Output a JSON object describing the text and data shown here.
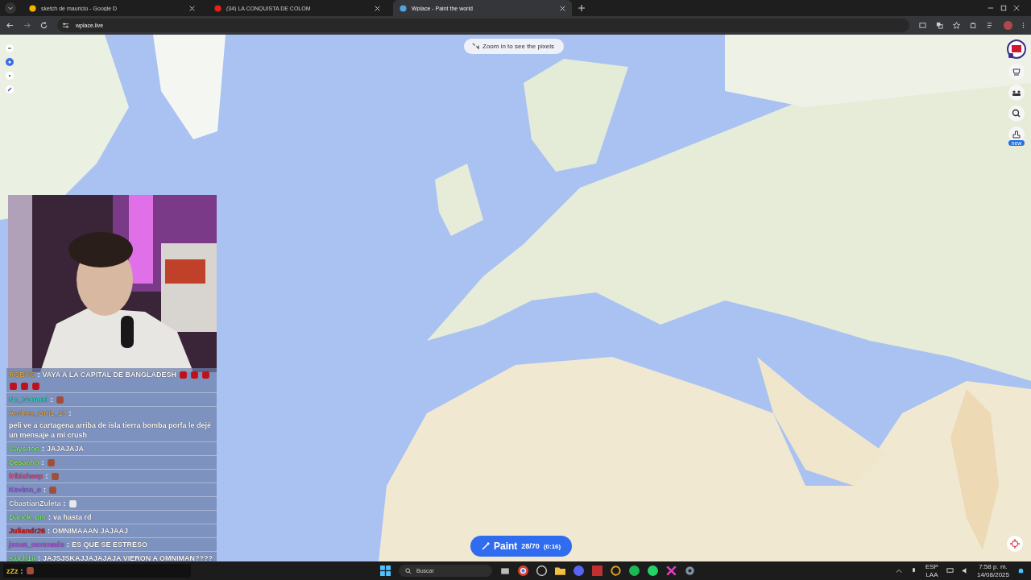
{
  "browser": {
    "tabs": [
      {
        "title": "sketch de mauricio - Google D",
        "selected": false
      },
      {
        "title": "(34) LA CONQUISTA DE COLOM",
        "selected": false
      },
      {
        "title": "Wplace - Paint the world",
        "selected": true
      }
    ],
    "url": "wplace.live"
  },
  "map": {
    "kind": "picture",
    "hint": "Zoom in to see the pixels",
    "paint": {
      "label": "Paint",
      "count": "28/70",
      "timer": "(0:16)"
    },
    "badge": "new"
  },
  "chat_separator": ":",
  "chat": [
    {
      "user": "ROBYC",
      "color": "#d9a441",
      "parts": [
        {
          "kind": "text",
          "text": "VAYA A LA CAPITAL DE BANGLADESH"
        },
        {
          "kind": "emote",
          "color": "#c0101a"
        },
        {
          "kind": "emote",
          "color": "#c0101a"
        },
        {
          "kind": "emote",
          "color": "#c0101a"
        },
        {
          "kind": "emote",
          "color": "#c0101a"
        },
        {
          "kind": "emote",
          "color": "#c0101a"
        },
        {
          "kind": "emote",
          "color": "#c0101a"
        }
      ]
    },
    {
      "user": "Ne_Samuel",
      "color": "#3ad6c8",
      "parts": [
        {
          "kind": "emote",
          "color": "#a0503a"
        }
      ]
    },
    {
      "user": "Andres_Ortiz_13",
      "color": "#e0a84a",
      "parts": [
        {
          "kind": "text",
          "text": "peli ve a cartagena arriba de isla tierra bomba porfa le dejé un mensaje a mi crush"
        }
      ]
    },
    {
      "user": "Caysitoo",
      "color": "#7cf07c",
      "parts": [
        {
          "kind": "text",
          "text": "JAJAJAJA"
        }
      ]
    },
    {
      "user": "Cesacho",
      "color": "#8cf03c",
      "parts": [
        {
          "kind": "emote",
          "color": "#a0503a"
        }
      ]
    },
    {
      "user": "frikisheep",
      "color": "#e0508a",
      "parts": [
        {
          "kind": "emote",
          "color": "#a0503a"
        }
      ]
    },
    {
      "user": "Kevinn_c",
      "color": "#a060f0",
      "parts": [
        {
          "kind": "emote",
          "color": "#a0503a"
        }
      ]
    },
    {
      "user": "CbastianZuleta",
      "color": "#f0f0f0",
      "parts": [
        {
          "kind": "emote",
          "color": "#e8e8e8"
        }
      ]
    },
    {
      "user": "Darick_pm",
      "color": "#7cf07c",
      "parts": [
        {
          "kind": "text",
          "text": "va hasta rd"
        }
      ]
    },
    {
      "user": "Juliandr26",
      "color": "#d02020",
      "parts": [
        {
          "kind": "text",
          "text": "OMNIMAAAN JAJAAJ"
        }
      ]
    },
    {
      "user": "jesus_coronado",
      "color": "#b060e0",
      "parts": [
        {
          "kind": "text",
          "text": "ES QUE SE ESTRESO"
        }
      ]
    },
    {
      "user": "salch1ii",
      "color": "#7cf07c",
      "parts": [
        {
          "kind": "text",
          "text": "JAJSJSKAJJAJAJAJA VIERON A OMNIMAN????"
        }
      ]
    },
    {
      "user": "zZz",
      "color": "#e0c020",
      "parts": [
        {
          "kind": "emote",
          "color": "#a0503a"
        }
      ]
    }
  ],
  "taskbar": {
    "search": "Buscar",
    "lang": "ESP",
    "layout": "LAA",
    "time": "7:58 p. m.",
    "date": "14/08/2025"
  }
}
